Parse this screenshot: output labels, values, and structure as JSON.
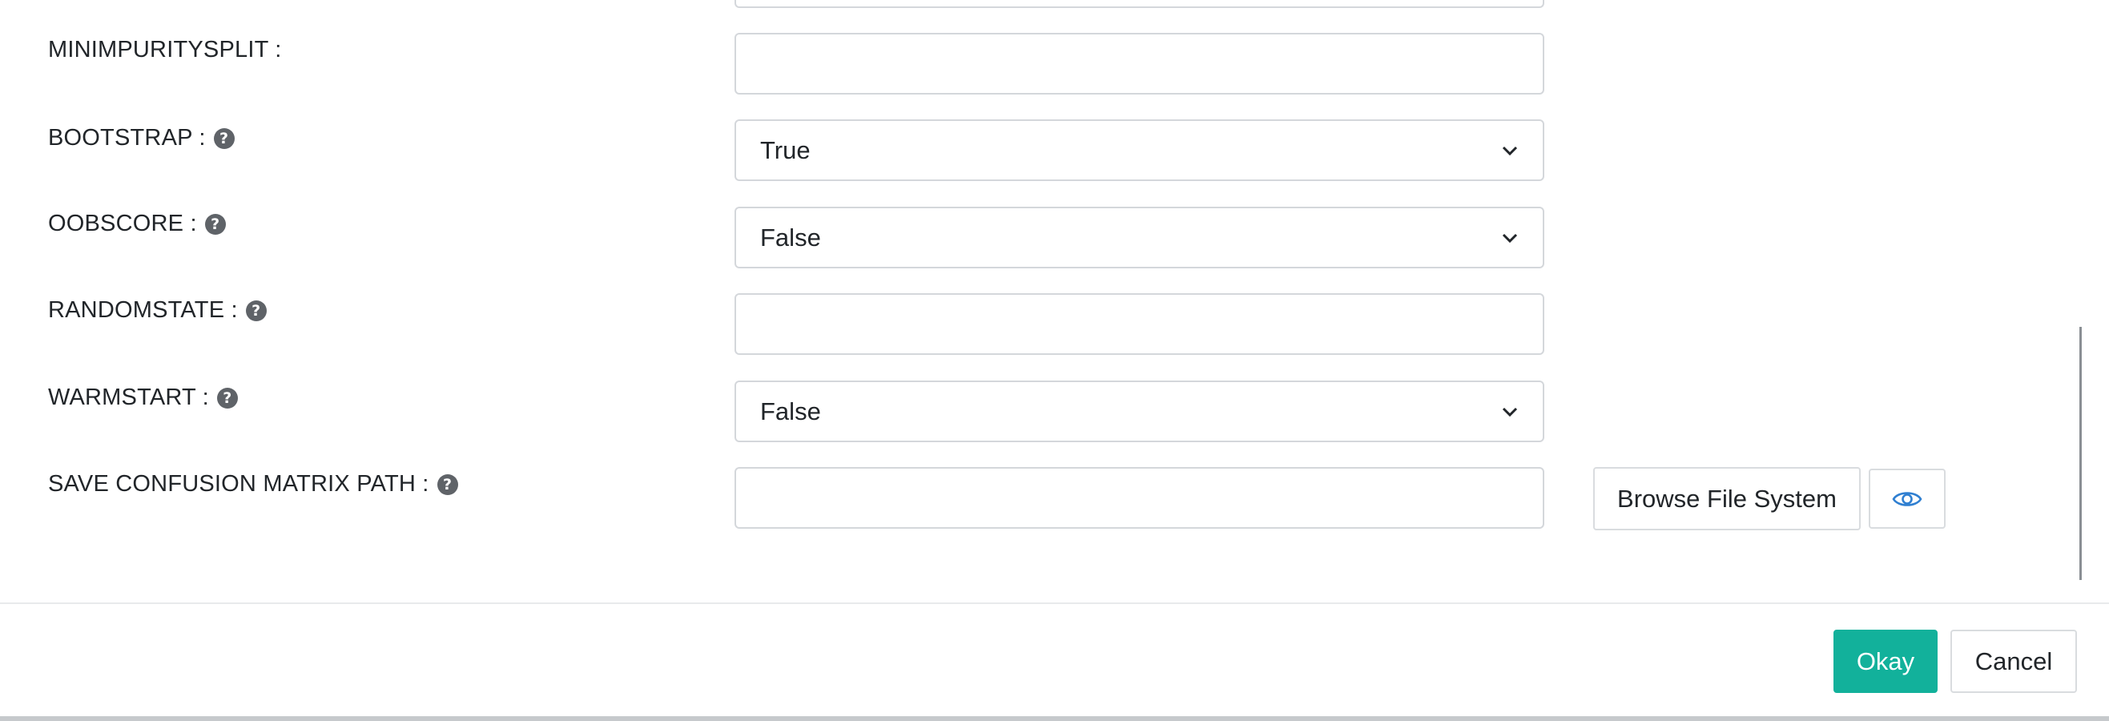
{
  "fields": [
    {
      "label": "MINIMPURITYSPLIT :",
      "help": false,
      "type": "text",
      "value": ""
    },
    {
      "label": "BOOTSTRAP :",
      "help": true,
      "type": "select",
      "value": "True"
    },
    {
      "label": "OOBSCORE :",
      "help": true,
      "type": "select",
      "value": "False"
    },
    {
      "label": "RANDOMSTATE :",
      "help": true,
      "type": "text",
      "value": ""
    },
    {
      "label": "WARMSTART :",
      "help": true,
      "type": "select",
      "value": "False"
    },
    {
      "label": "SAVE CONFUSION MATRIX PATH :",
      "help": true,
      "type": "text",
      "value": ""
    }
  ],
  "help_glyph": "?",
  "browse_label": "Browse File System",
  "buttons": {
    "okay": "Okay",
    "cancel": "Cancel"
  },
  "colors": {
    "primary": "#12b19b",
    "eye_icon": "#2f7fd1",
    "help_icon": "#5f6368"
  },
  "icons": {
    "help": "question-circle-icon",
    "preview": "eye-icon",
    "dropdown": "chevron-down-icon"
  }
}
